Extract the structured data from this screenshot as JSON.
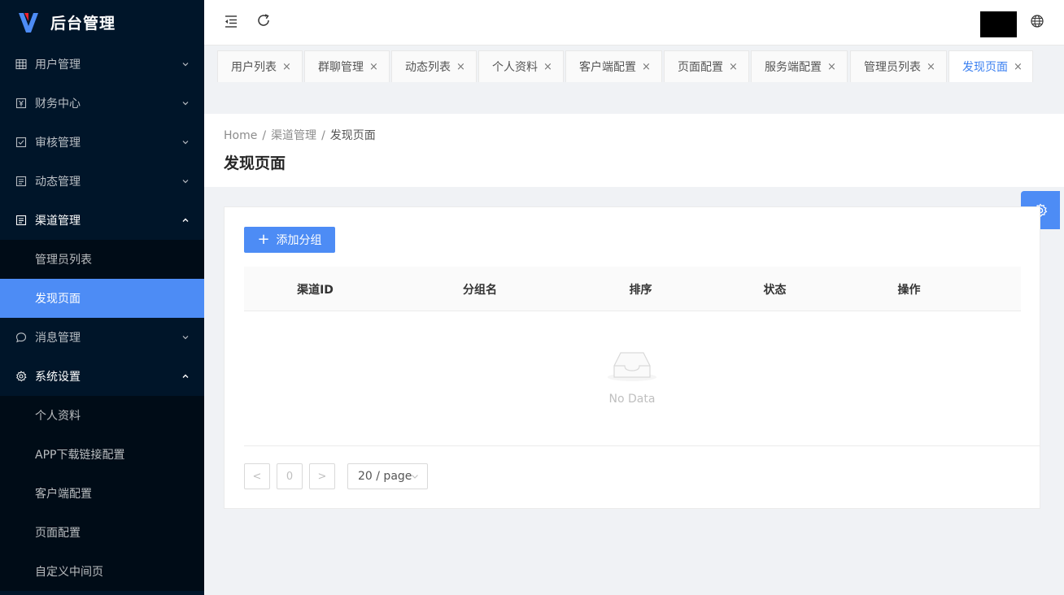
{
  "app": {
    "title": "后台管理"
  },
  "sidebar": {
    "items": [
      {
        "label": "用户管理",
        "icon": "table-icon",
        "expanded": false
      },
      {
        "label": "财务中心",
        "icon": "finance-icon",
        "expanded": false
      },
      {
        "label": "审核管理",
        "icon": "checkbox-icon",
        "expanded": false
      },
      {
        "label": "动态管理",
        "icon": "document-icon",
        "expanded": false
      },
      {
        "label": "渠道管理",
        "icon": "document-icon",
        "expanded": true,
        "children": [
          {
            "label": "管理员列表",
            "active": false
          },
          {
            "label": "发现页面",
            "active": true
          }
        ]
      },
      {
        "label": "消息管理",
        "icon": "chat-icon",
        "expanded": false
      },
      {
        "label": "系统设置",
        "icon": "gear-icon",
        "expanded": true,
        "children": [
          {
            "label": "个人资料",
            "active": false
          },
          {
            "label": "APP下载链接配置",
            "active": false
          },
          {
            "label": "客户端配置",
            "active": false
          },
          {
            "label": "页面配置",
            "active": false
          },
          {
            "label": "自定义中间页",
            "active": false
          }
        ]
      }
    ]
  },
  "tabs": [
    {
      "label": "用户列表",
      "active": false
    },
    {
      "label": "群聊管理",
      "active": false
    },
    {
      "label": "动态列表",
      "active": false
    },
    {
      "label": "个人资料",
      "active": false
    },
    {
      "label": "客户端配置",
      "active": false
    },
    {
      "label": "页面配置",
      "active": false
    },
    {
      "label": "服务端配置",
      "active": false
    },
    {
      "label": "管理员列表",
      "active": false
    },
    {
      "label": "发现页面",
      "active": true
    }
  ],
  "tab_close_glyph": "×",
  "breadcrumb": {
    "home": "Home",
    "parent": "渠道管理",
    "current": "发现页面",
    "separator": "/"
  },
  "page": {
    "title": "发现页面"
  },
  "toolbar": {
    "add_label": "添加分组",
    "add_plus": "+"
  },
  "table": {
    "columns": [
      "渠道ID",
      "分组名",
      "排序",
      "状态",
      "操作"
    ],
    "rows": [],
    "empty_text": "No Data"
  },
  "pagination": {
    "prev": "<",
    "page": "0",
    "next": ">",
    "page_size": "20 / page"
  },
  "colors": {
    "sidebar_bg": "#001529",
    "accent": "#4d8cf5",
    "active_tab_text": "#3a7ff0"
  }
}
